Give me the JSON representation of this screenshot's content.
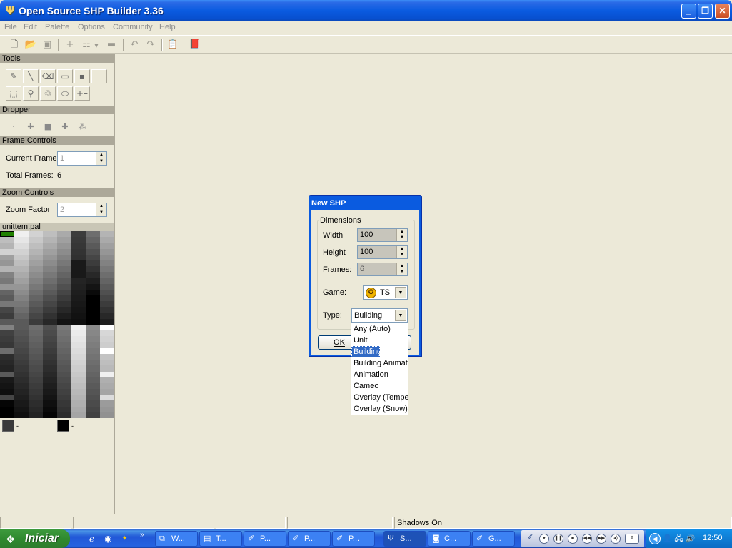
{
  "window": {
    "title": "Open Source SHP Builder 3.36",
    "icon": "app-shp-icon"
  },
  "menu": {
    "items": [
      "File",
      "Edit",
      "Palette",
      "Options",
      "Community",
      "Help"
    ]
  },
  "toolbar": {
    "icons": [
      "new-icon",
      "open-icon",
      "save-icon",
      "add-frame-icon",
      "multi-icon",
      "preview-icon",
      "undo-icon",
      "redo-icon",
      "properties-icon",
      "help-book-icon"
    ]
  },
  "left_panel": {
    "tools_header": "Tools",
    "dropper_header": "Dropper",
    "frame_controls_header": "Frame Controls",
    "current_frame_label": "Current Frame",
    "current_frame_value": "1",
    "total_frames_label": "Total Frames:",
    "total_frames_value": "6",
    "zoom_controls_header": "Zoom Controls",
    "zoom_factor_label": "Zoom Factor",
    "zoom_factor_value": "2",
    "palette_name": "unittem.pal",
    "swatch1_color": "#3a3a3a",
    "swatch2_color": "#000000",
    "swatch_dot": "-"
  },
  "status": {
    "panel5": "Shadows On"
  },
  "dialog": {
    "title": "New SHP",
    "group_label": "Dimensions",
    "width_label": "Width",
    "width_value": "100",
    "height_label": "Height",
    "height_value": "100",
    "frames_label": "Frames:",
    "frames_value": "6",
    "game_label": "Game:",
    "game_value": "TS",
    "type_label": "Type:",
    "type_value": "Building",
    "ok_label": "OK"
  },
  "dropdown": {
    "options": [
      "Any (Auto)",
      "Unit",
      "Building",
      "Building Animati",
      "Animation",
      "Cameo",
      "Overlay (Tempe",
      "Overlay (Snow)"
    ],
    "selected_index": 2
  },
  "taskbar": {
    "start_label": "Iniciar",
    "tasks": [
      {
        "label": "W...",
        "icon": "windows-explorer-icon"
      },
      {
        "label": "T...",
        "icon": "word-icon"
      },
      {
        "label": "P...",
        "icon": "paint-icon"
      },
      {
        "label": "P...",
        "icon": "paint-icon"
      },
      {
        "label": "P...",
        "icon": "paint-icon"
      },
      {
        "label": "S...",
        "icon": "shp-builder-icon"
      },
      {
        "label": "C...",
        "icon": "cmd-icon"
      },
      {
        "label": "G...",
        "icon": "gimp-icon"
      }
    ],
    "clock": "12:50"
  },
  "colors": {
    "titlebar": "#0a5be0",
    "face": "#ece9d8",
    "selection": "#316ac5",
    "start_green": "#3d9a3d",
    "palette_cursor": "#208000"
  }
}
